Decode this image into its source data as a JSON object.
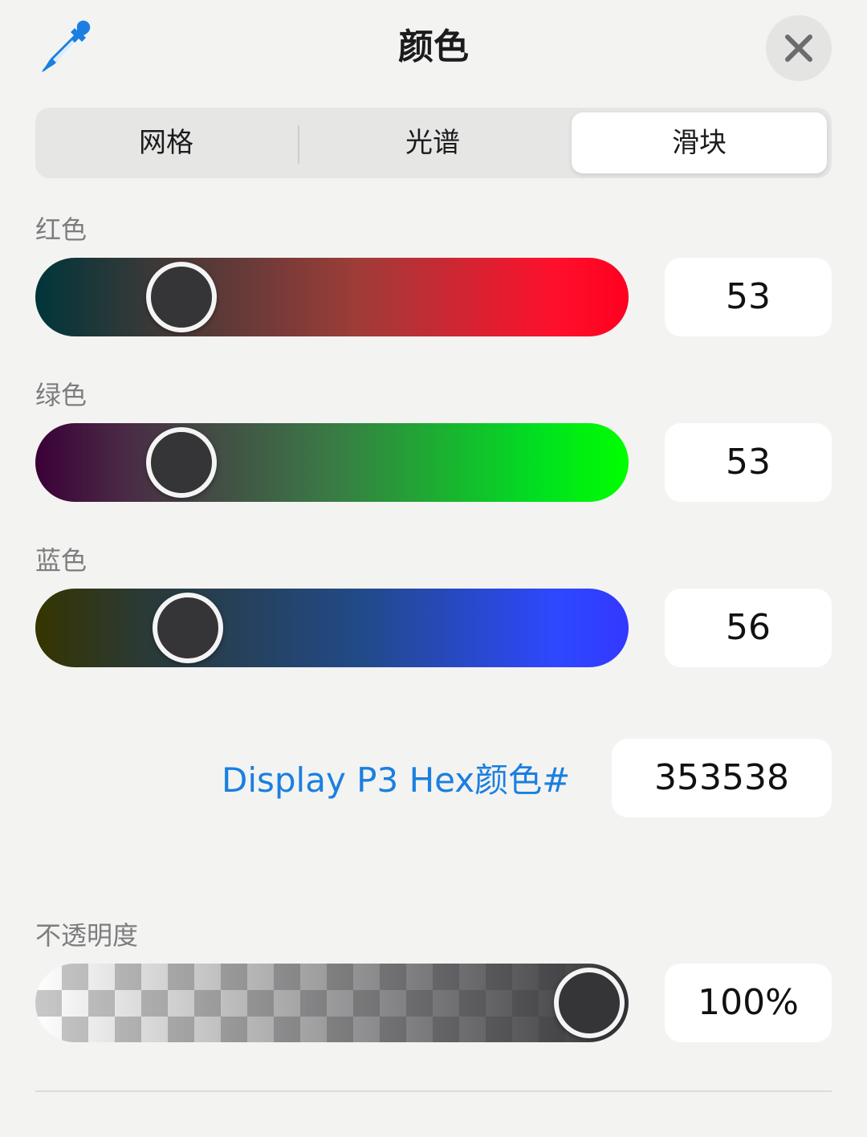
{
  "header": {
    "title": "颜色",
    "eyedropper_icon": "eyedropper-icon",
    "close_icon": "close-icon",
    "accent_color": "#1a7fe0"
  },
  "tabs": [
    {
      "label": "网格",
      "selected": false
    },
    {
      "label": "光谱",
      "selected": false
    },
    {
      "label": "滑块",
      "selected": true
    }
  ],
  "sliders": {
    "red": {
      "label": "红色",
      "value": "53",
      "level": 53
    },
    "green": {
      "label": "绿色",
      "value": "53",
      "level": 53
    },
    "blue": {
      "label": "蓝色",
      "value": "56",
      "level": 56
    }
  },
  "hex": {
    "label": "Display P3 Hex颜色#",
    "value": "353538"
  },
  "opacity": {
    "label": "不透明度",
    "value": "100%",
    "level": 100
  },
  "current_color": "#353538"
}
